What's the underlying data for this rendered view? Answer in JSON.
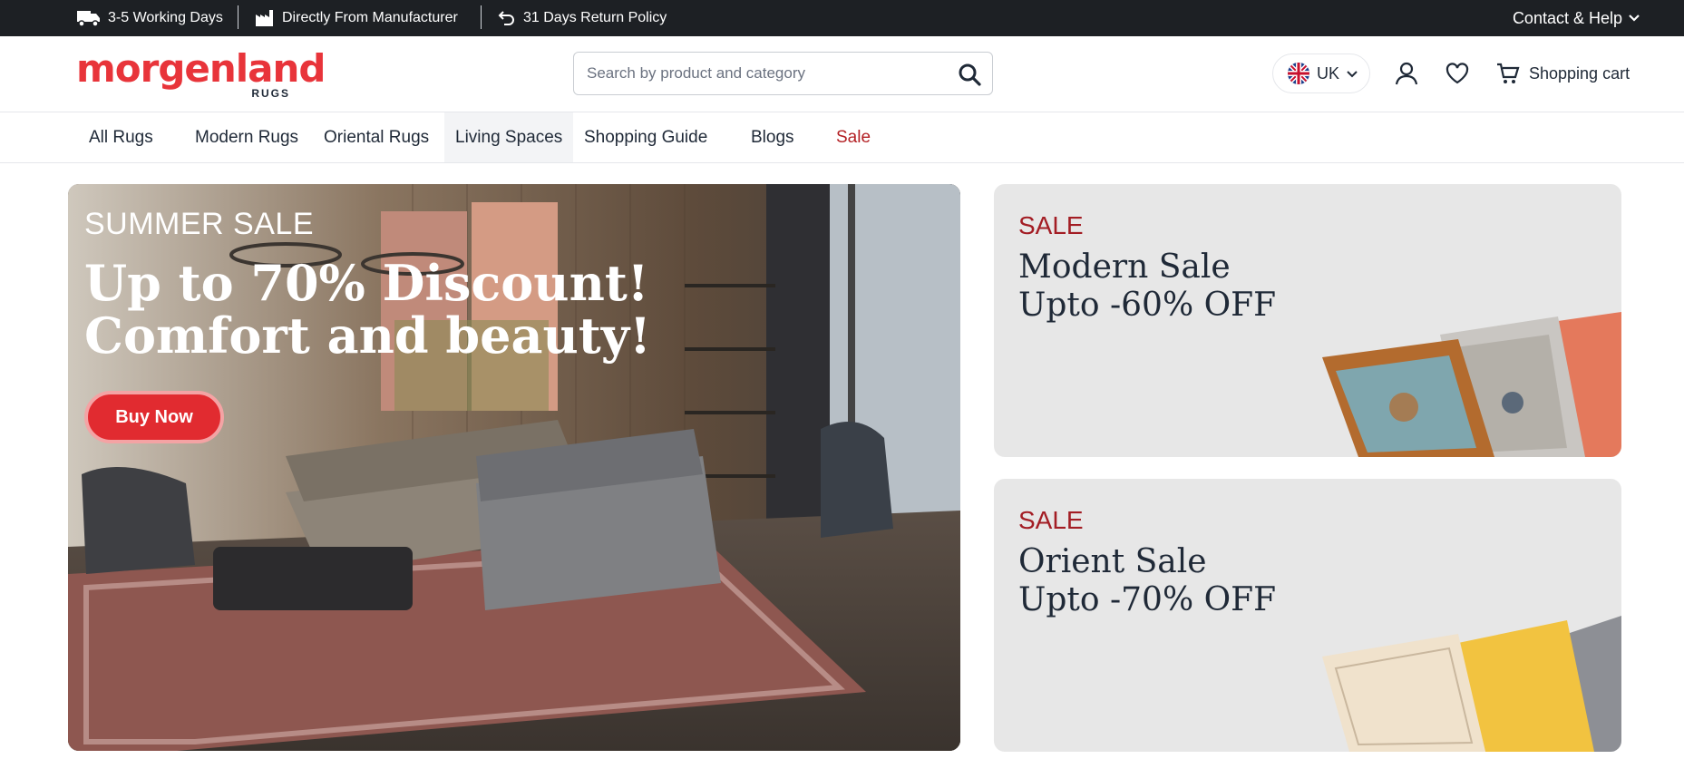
{
  "topbar": {
    "delivery": "3-5 Working Days",
    "manufacturer": "Directly From Manufacturer",
    "returns": "31 Days Return Policy",
    "contact": "Contact & Help"
  },
  "header": {
    "logo_word": "morgenland",
    "logo_sub": "RUGS",
    "search_placeholder": "Search by product and category",
    "language": "UK",
    "cart_label": "Shopping cart"
  },
  "nav": {
    "items": [
      "All Rugs",
      "Modern Rugs",
      "Oriental Rugs",
      "Living Spaces",
      "Shopping Guide",
      "Blogs",
      "Sale"
    ]
  },
  "hero": {
    "kicker": "SUMMER SALE",
    "line1": "Up to 70% Discount!",
    "line2": "Comfort and beauty!",
    "cta": "Buy Now"
  },
  "promos": [
    {
      "tag": "SALE",
      "line1": "Modern Sale",
      "line2": "Upto -60% OFF"
    },
    {
      "tag": "SALE",
      "line1": "Orient Sale",
      "line2": "Upto -70% OFF"
    }
  ],
  "colors": {
    "brand_red": "#e8343a",
    "sale_red": "#a31d24",
    "topbar_bg": "#1d2024",
    "promo_bg": "#e7e7e7"
  }
}
